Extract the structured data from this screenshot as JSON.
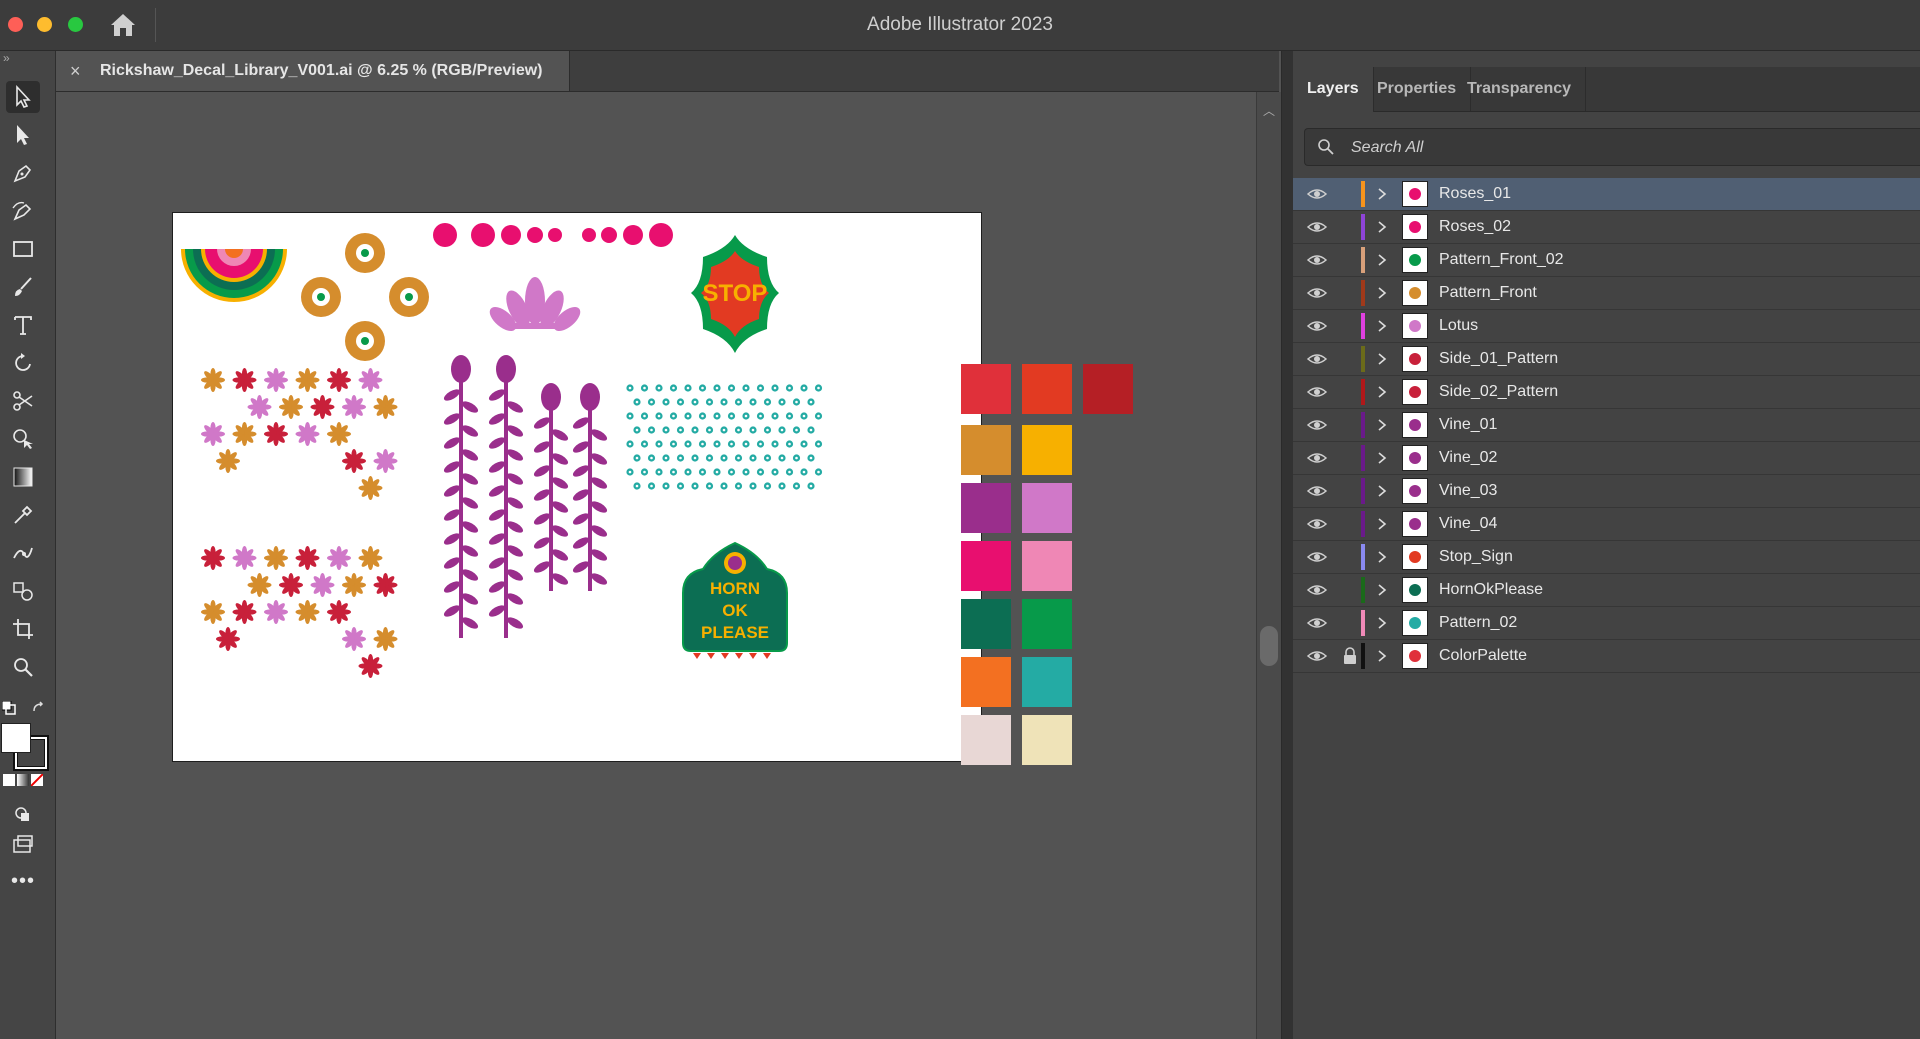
{
  "window": {
    "app_title": "Adobe Illustrator 2023",
    "traffic_lights": {
      "close": "#fe5f57",
      "minimize": "#febc2e",
      "maximize": "#28c840"
    }
  },
  "document": {
    "tab_title": "Rickshaw_Decal_Library_V001.ai @ 6.25 % (RGB/Preview)",
    "close_glyph": "×"
  },
  "tools": [
    {
      "name": "selection-tool",
      "icon": "arrow-icon"
    },
    {
      "name": "direct-selection-tool",
      "icon": "white-arrow-icon"
    },
    {
      "name": "pen-tool",
      "icon": "pen-icon"
    },
    {
      "name": "curvature-tool",
      "icon": "curvature-icon"
    },
    {
      "name": "rectangle-tool",
      "icon": "rectangle-icon"
    },
    {
      "name": "paintbrush-tool",
      "icon": "brush-icon"
    },
    {
      "name": "type-tool",
      "icon": "type-icon"
    },
    {
      "name": "rotate-tool",
      "icon": "rotate-icon"
    },
    {
      "name": "scissors-tool",
      "icon": "scissors-icon"
    },
    {
      "name": "shape-builder-tool",
      "icon": "shape-builder-icon"
    },
    {
      "name": "gradient-tool",
      "icon": "gradient-icon"
    },
    {
      "name": "eyedropper-tool",
      "icon": "eyedropper-icon"
    },
    {
      "name": "puppet-warp-tool",
      "icon": "puppet-warp-icon"
    },
    {
      "name": "blend-tool",
      "icon": "blend-icon"
    },
    {
      "name": "artboard-tool",
      "icon": "artboard-icon"
    },
    {
      "name": "zoom-tool",
      "icon": "zoom-icon"
    }
  ],
  "artwork": {
    "stop_sign_text": "STOP",
    "horn_sign_text": [
      "HORN",
      "OK",
      "PLEASE"
    ]
  },
  "palette_swatches": [
    "#e0303a",
    "#e23a22",
    "#b51f25",
    "#d58d2d",
    "#f7b000",
    "#9a2e8c",
    "#d078c8",
    "#e80f6f",
    "#ef87b5",
    "#0c6e53",
    "#079a4a",
    "#f37021",
    "#24aba4",
    "#e8d7d5",
    "#efe3b8"
  ],
  "panel": {
    "tabs": [
      "Layers",
      "Properties",
      "Transparency"
    ],
    "active_tab": "Layers",
    "search_placeholder": "Search All"
  },
  "layers": [
    {
      "name": "Roses_01",
      "color": "#f7941d",
      "selected": true,
      "locked": false
    },
    {
      "name": "Roses_02",
      "color": "#8e44d8",
      "selected": false,
      "locked": false
    },
    {
      "name": "Pattern_Front_02",
      "color": "#d8a07a",
      "selected": false,
      "locked": false
    },
    {
      "name": "Pattern_Front",
      "color": "#a0391a",
      "selected": false,
      "locked": false
    },
    {
      "name": "Lotus",
      "color": "#e040e0",
      "selected": false,
      "locked": false
    },
    {
      "name": "Side_01_Pattern",
      "color": "#6b6b1a",
      "selected": false,
      "locked": false
    },
    {
      "name": "Side_02_Pattern",
      "color": "#b0181a",
      "selected": false,
      "locked": false
    },
    {
      "name": "Vine_01",
      "color": "#6a1a8a",
      "selected": false,
      "locked": false
    },
    {
      "name": "Vine_02",
      "color": "#6a1a8a",
      "selected": false,
      "locked": false
    },
    {
      "name": "Vine_03",
      "color": "#6a1a8a",
      "selected": false,
      "locked": false
    },
    {
      "name": "Vine_04",
      "color": "#6a1a8a",
      "selected": false,
      "locked": false
    },
    {
      "name": "Stop_Sign",
      "color": "#8a8af0",
      "selected": false,
      "locked": false
    },
    {
      "name": "HornOkPlease",
      "color": "#1a6a1a",
      "selected": false,
      "locked": false
    },
    {
      "name": "Pattern_02",
      "color": "#f08ab8",
      "selected": false,
      "locked": false
    },
    {
      "name": "ColorPalette",
      "color": "#111111",
      "selected": false,
      "locked": true
    }
  ]
}
